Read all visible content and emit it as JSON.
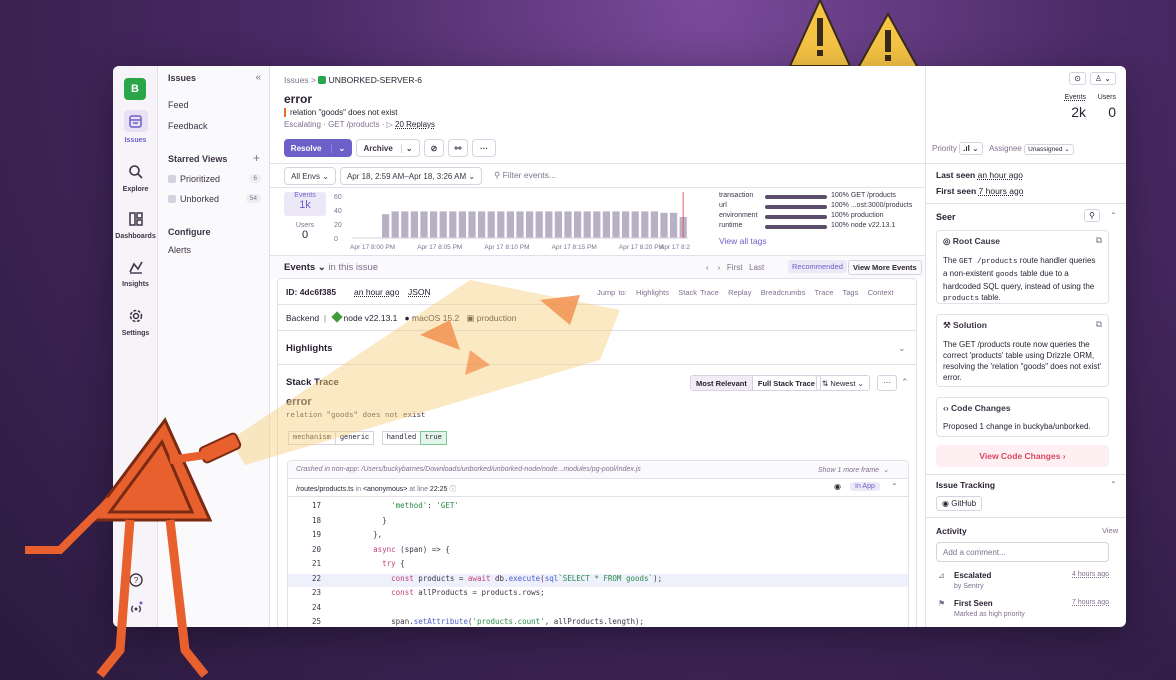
{
  "rail": {
    "org_initial": "B",
    "items": [
      {
        "label": "Issues",
        "icon": "issues-icon"
      },
      {
        "label": "Explore",
        "icon": "search-icon"
      },
      {
        "label": "Dashboards",
        "icon": "dashboard-icon"
      },
      {
        "label": "Insights",
        "icon": "insights-icon"
      },
      {
        "label": "Settings",
        "icon": "gear-icon"
      }
    ],
    "bottom_icons": [
      "help-icon",
      "broadcast-icon"
    ]
  },
  "subnav": {
    "title": "Issues",
    "items": [
      "Feed",
      "Feedback"
    ],
    "starred_title": "Starred Views",
    "views": [
      {
        "label": "Prioritized",
        "count": "6"
      },
      {
        "label": "Unborked",
        "count": "54"
      }
    ],
    "configure_title": "Configure",
    "configure_items": [
      "Alerts"
    ]
  },
  "header": {
    "breadcrumb_root": "Issues",
    "breadcrumb_sep": ">",
    "project": "UNBORKED-SERVER-6",
    "title": "error",
    "message": "relation \"goods\" does not exist",
    "status": "Escalating",
    "transaction": "GET /products",
    "replays": "20 Replays",
    "events_label": "Events",
    "events_value": "2k",
    "users_label": "Users",
    "users_value": "0"
  },
  "toolbar": {
    "resolve": "Resolve",
    "archive": "Archive",
    "more": "···",
    "priority_label": "Priority",
    "assignee_label": "Assignee",
    "assignee_value": "Unassigned"
  },
  "filters": {
    "env": "All Envs",
    "date_range": "Apr 18, 2:59 AM–Apr 18, 3:26 AM",
    "search_placeholder": "Filter events..."
  },
  "stats": {
    "events_label": "Events",
    "events_value": "1k",
    "users_label": "Users",
    "users_value": "0"
  },
  "chart_data": {
    "type": "bar",
    "yticks": [
      "60",
      "40",
      "20",
      "0"
    ],
    "ylim": [
      0,
      60
    ],
    "xticks": [
      "Apr 17 8:00 PM",
      "Apr 17 8:05 PM",
      "Apr 17 8:10 PM",
      "Apr 17 8:15 PM",
      "Apr 17 8:20 PM",
      "Apr 17 8:2"
    ],
    "values": [
      0,
      0,
      0,
      34,
      38,
      38,
      38,
      38,
      38,
      38,
      38,
      38,
      38,
      38,
      38,
      38,
      38,
      38,
      38,
      38,
      38,
      38,
      38,
      38,
      38,
      38,
      38,
      38,
      38,
      38,
      38,
      38,
      36,
      36,
      30
    ],
    "bar_color": "#b8b0c4",
    "marker_color": "#e05d6f"
  },
  "tags": {
    "rows": [
      {
        "key": "transaction",
        "value": "100% GET /products"
      },
      {
        "key": "url",
        "value": "100% ...ost:3000/products"
      },
      {
        "key": "environment",
        "value": "100% production"
      },
      {
        "key": "runtime",
        "value": "100% node v22.13.1"
      }
    ],
    "view_all": "View all tags"
  },
  "events": {
    "heading": "Events",
    "scope": "in this issue",
    "first": "First",
    "last": "Last",
    "recommended": "Recommended",
    "view_more": "View More Events",
    "id_label": "ID: 4dc6f385",
    "time": "an hour ago",
    "json": "JSON",
    "jump_to": "Jump to:",
    "jump_links": [
      "Highlights",
      "Stack Trace",
      "Replay",
      "Breadcrumbs",
      "Trace",
      "Tags",
      "Context"
    ],
    "backend": "Backend",
    "node": "node v22.13.1",
    "os": "macOS 15.2",
    "env": "production"
  },
  "highlights": {
    "title": "Highlights"
  },
  "stack": {
    "title": "Stack Trace",
    "most_relevant": "Most Relevant",
    "full": "Full Stack Trace",
    "newest": "Newest",
    "error_type": "error",
    "error_msg": "relation \"goods\" does not exist",
    "mechanism_k": "mechanism",
    "mechanism_v": "generic",
    "handled_k": "handled",
    "handled_v": "true",
    "crashed_label": "Crashed in non-app:",
    "crashed_path": "/Users/buckybarnes/Downloads/unborked/unborked-node/node...modules/pg-pool/index.js",
    "show_more": "Show 1 more frame",
    "frame_file": "/routes/products.ts",
    "frame_in": "in",
    "frame_fn": "<anonymous>",
    "frame_at": "at line",
    "frame_line": "22:25",
    "in_app": "In App",
    "code": [
      {
        "n": "17",
        "t": "          'method': 'GET'"
      },
      {
        "n": "18",
        "t": "        }"
      },
      {
        "n": "19",
        "t": "      },"
      },
      {
        "n": "20",
        "t": "      async (span) => {"
      },
      {
        "n": "21",
        "t": "        try {"
      },
      {
        "n": "22",
        "t": "          const products = await db.execute(sql`SELECT * FROM goods`);"
      },
      {
        "n": "23",
        "t": "          const allProducts = products.rows;"
      },
      {
        "n": "24",
        "t": ""
      },
      {
        "n": "25",
        "t": "          span.setAttribute('products.count', allProducts.length);"
      }
    ]
  },
  "side": {
    "last_seen_label": "Last seen",
    "last_seen": "an hour ago",
    "first_seen_label": "First seen",
    "first_seen": "7 hours ago",
    "seer": "Seer",
    "root_cause_title": "Root Cause",
    "root_cause_pre": "The",
    "root_cause_code1": "GET /products",
    "root_cause_mid": "route handler queries a non-existent",
    "root_cause_code2": "goods",
    "root_cause_mid2": "table due to a hardcoded SQL query, instead of using the",
    "root_cause_code3": "products",
    "root_cause_post": "table.",
    "solution_title": "Solution",
    "solution_text": "The GET /products route now queries the correct 'products' table using Drizzle ORM, resolving the 'relation \"goods\" does not exist' error.",
    "code_changes_title": "Code Changes",
    "code_changes_text": "Proposed 1 change in buckyba/unborked.",
    "view_code_changes": "View Code Changes",
    "issue_tracking": "Issue Tracking",
    "github": "GitHub",
    "activity": "Activity",
    "view": "View",
    "comment_placeholder": "Add a comment...",
    "activity_items": [
      {
        "title": "Escalated",
        "sub": "by Sentry",
        "time": "4 hours ago"
      },
      {
        "title": "First Seen",
        "sub": "Marked as high priority",
        "time": "7 hours ago"
      }
    ]
  }
}
